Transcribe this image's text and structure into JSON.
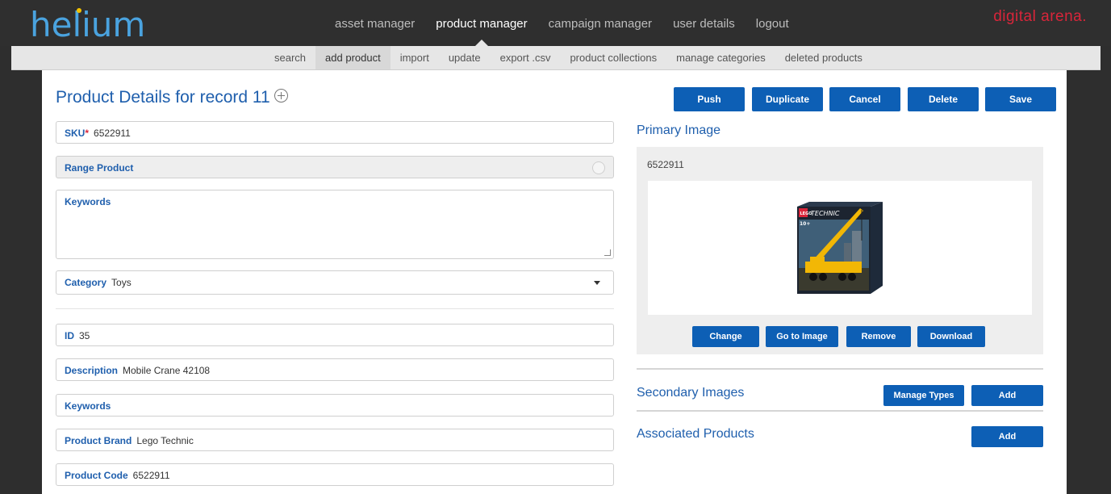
{
  "header": {
    "logo": "helium",
    "brand": "digital arena.",
    "nav": [
      "asset manager",
      "product manager",
      "campaign manager",
      "user details",
      "logout"
    ],
    "active_nav": "product manager"
  },
  "subnav": {
    "items": [
      "search",
      "add product",
      "import",
      "update",
      "export .csv",
      "product collections",
      "manage categories",
      "deleted products"
    ],
    "active": "add product"
  },
  "page": {
    "title": "Product Details for record 11"
  },
  "actions": [
    "Push",
    "Duplicate",
    "Cancel",
    "Delete",
    "Save"
  ],
  "form": {
    "sku": {
      "label": "SKU",
      "required_mark": "*",
      "value": "6522911"
    },
    "range_product": {
      "label": "Range Product"
    },
    "keywords_area": {
      "label": "Keywords",
      "value": ""
    },
    "category": {
      "label": "Category",
      "value": "Toys"
    },
    "id": {
      "label": "ID",
      "value": "35"
    },
    "description": {
      "label": "Description",
      "value": "Mobile Crane 42108"
    },
    "keywords": {
      "label": "Keywords",
      "value": ""
    },
    "brand": {
      "label": "Product Brand",
      "value": "Lego Technic"
    },
    "code": {
      "label": "Product Code",
      "value": "6522911"
    }
  },
  "primary_image": {
    "title": "Primary Image",
    "sku": "6522911",
    "buttons": [
      "Change",
      "Go to Image",
      "Remove",
      "Download"
    ],
    "box_brand": "TECHNIC",
    "box_logo": "LEGO",
    "box_age": "10+"
  },
  "secondary_images": {
    "title": "Secondary Images",
    "manage_label": "Manage Types",
    "add_label": "Add"
  },
  "associated_products": {
    "title": "Associated Products",
    "add_label": "Add"
  },
  "colors": {
    "accent": "#0d5fb5",
    "label_blue": "#1f5fad",
    "logo_blue": "#4aa3df",
    "brand_red": "#d9253a",
    "topbar": "#2f2f2f"
  }
}
